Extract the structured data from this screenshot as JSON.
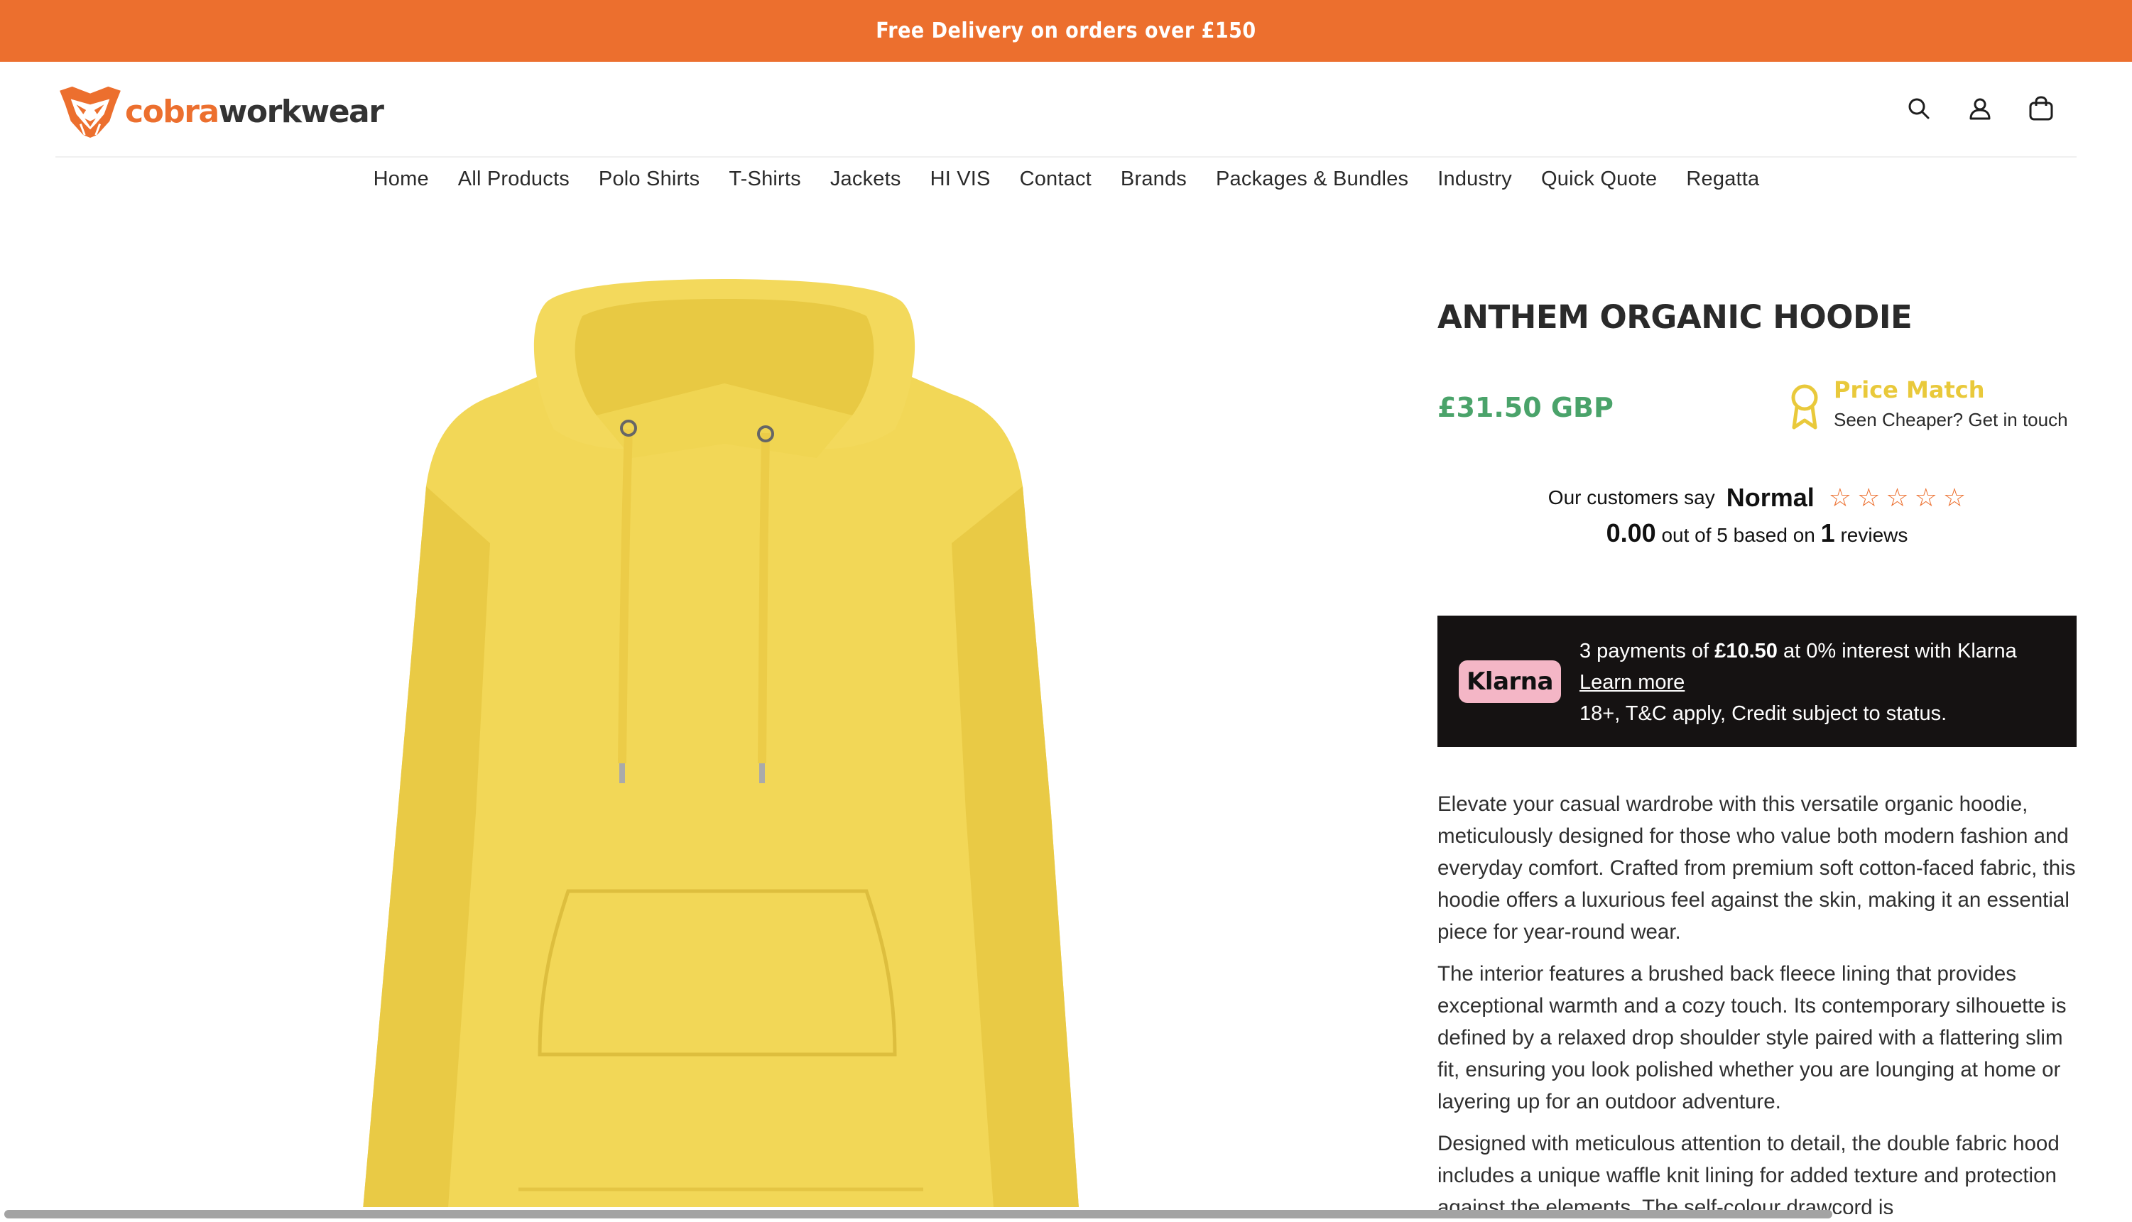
{
  "announcement": "Free Delivery on orders over £150",
  "logo": {
    "part1": "cobra",
    "part2": "workwear"
  },
  "header_icons": [
    "search-icon",
    "account-icon",
    "cart-icon"
  ],
  "nav": [
    "Home",
    "All Products",
    "Polo Shirts",
    "T-Shirts",
    "Jackets",
    "HI VIS",
    "Contact",
    "Brands",
    "Packages & Bundles",
    "Industry",
    "Quick Quote",
    "Regatta"
  ],
  "product": {
    "title": "ANTHEM ORGANIC HOODIE",
    "price": "£31.50 GBP",
    "image_color": "#f2d757"
  },
  "price_match": {
    "title": "Price Match",
    "subtitle": "Seen Cheaper? Get in touch"
  },
  "reviews": {
    "prefix": "Our customers say",
    "rating_word": "Normal",
    "stars_filled": 0,
    "stars_total": 5,
    "score": "0.00",
    "out_of_text": "out of 5 based on",
    "count": "1",
    "count_suffix": "reviews"
  },
  "klarna": {
    "badge": "Klarna",
    "line1_prefix": "3 payments of",
    "line1_amount": "£10.50",
    "line1_suffix": "at 0% interest with Klarna",
    "learn_more": "Learn more",
    "line3": "18+, T&C apply, Credit subject to status."
  },
  "description": [
    "Elevate your casual wardrobe with this versatile organic hoodie, meticulously designed for those who value both modern fashion and everyday comfort. Crafted from premium soft cotton-faced fabric, this hoodie offers a luxurious feel against the skin, making it an essential piece for year-round wear.",
    "The interior features a brushed back fleece lining that provides exceptional warmth and a cozy touch. Its contemporary silhouette is defined by a relaxed drop shoulder style paired with a flattering slim fit, ensuring you look polished whether you are lounging at home or layering up for an outdoor adventure.",
    "Designed with meticulous attention to detail, the double fabric hood includes a unique waffle knit lining for added texture and protection against the elements. The self-colour drawcord is"
  ],
  "colors": {
    "brand": "#ec6f2e",
    "price": "#4aa36a",
    "price_match": "#e9c93b",
    "klarna_bg": "#151212",
    "klarna_badge": "#f4b6c6"
  }
}
